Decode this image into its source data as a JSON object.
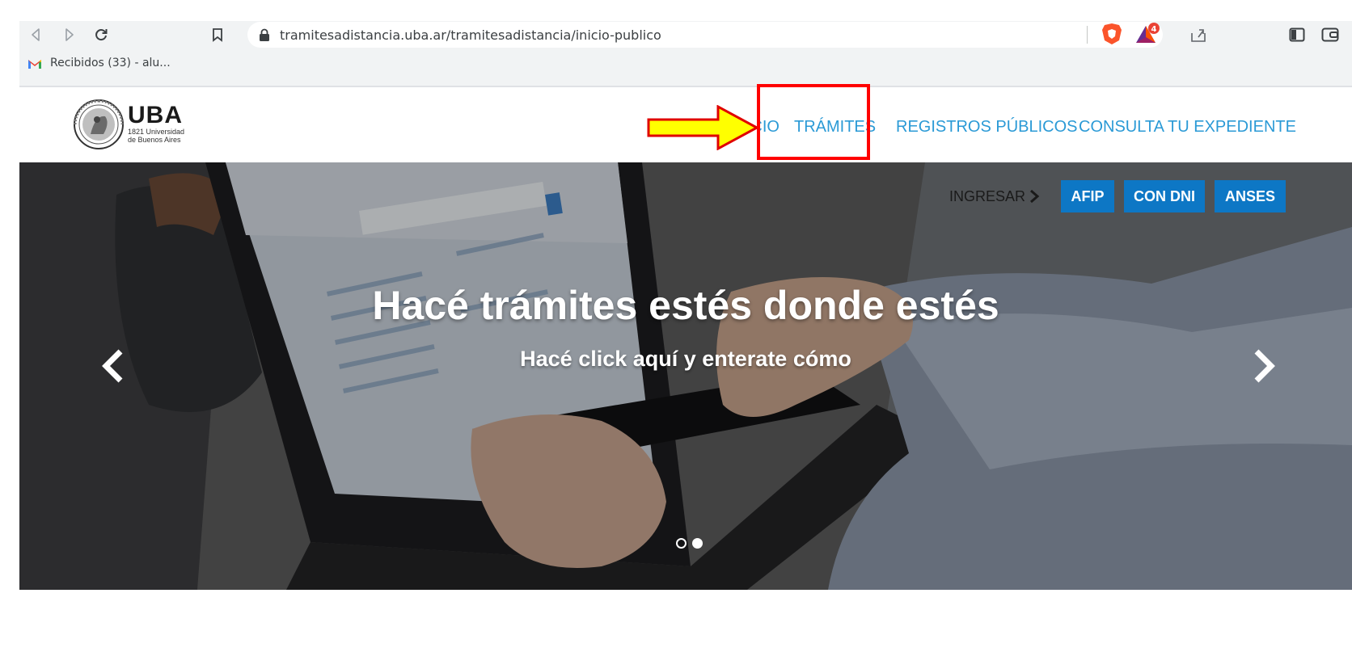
{
  "browser": {
    "url": "tramitesadistancia.uba.ar/tramitesadistancia/inicio-publico",
    "bookmark_label": "Recibidos (33) - alu...",
    "brave_badge_count": "4"
  },
  "site": {
    "logo": {
      "name": "UBA",
      "line1": "1821 Universidad",
      "line2": "de Buenos Aires"
    },
    "nav": {
      "inicio": "INICIO",
      "tramites": "TRÁMITES",
      "registros": "REGISTROS PÚBLICOS",
      "consulta": "CONSULTA TU EXPEDIENTE"
    },
    "colors": {
      "nav_link": "#2b9ad6",
      "login_button": "#0d77c5",
      "highlight": "#ff0000",
      "arrow_fill": "#ffff00"
    }
  },
  "hero": {
    "login_label": "INGRESAR",
    "buttons": [
      "AFIP",
      "CON DNI",
      "ANSES"
    ],
    "title": "Hacé trámites estés donde estés",
    "subtitle": "Hacé click aquí y enterate cómo",
    "active_slide": 2,
    "slide_count": 2
  },
  "icons": {
    "back": "back-arrow-icon",
    "forward": "forward-arrow-icon",
    "reload": "reload-icon",
    "bookmark": "bookmark-icon",
    "lock": "lock-icon",
    "share": "share-icon",
    "brave": "brave-shield-icon",
    "bat": "brave-rewards-icon",
    "sidebar": "sidebar-icon",
    "wallet": "wallet-icon",
    "prev": "chevron-left-icon",
    "next": "chevron-right-icon"
  }
}
